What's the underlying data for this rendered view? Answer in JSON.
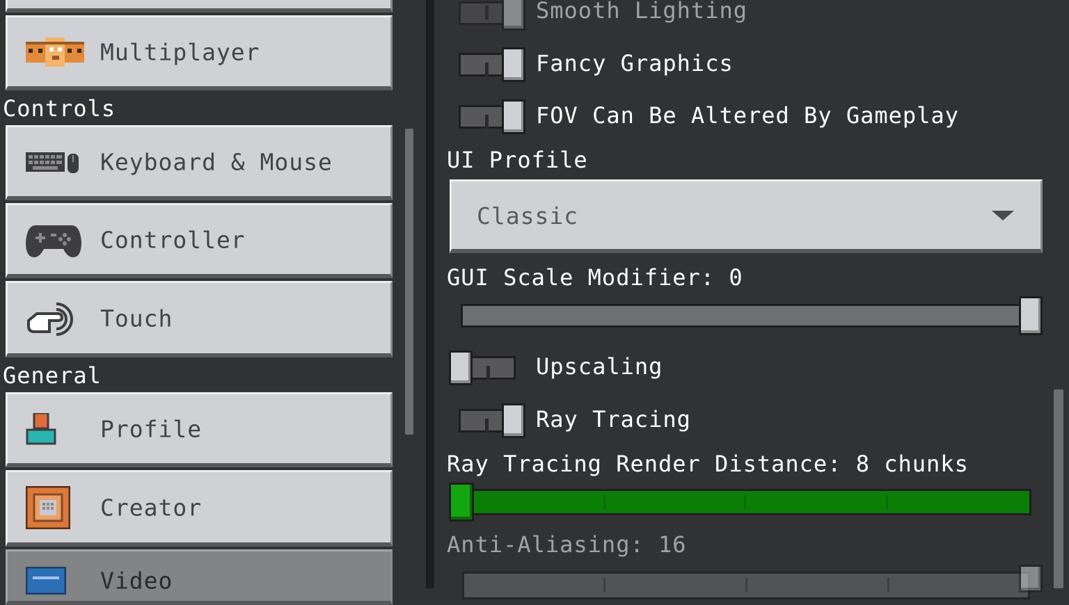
{
  "sidebar": {
    "items": [
      {
        "label": "",
        "icon": "blank"
      },
      {
        "label": "Multiplayer",
        "icon": "multiplayer-faces-icon"
      },
      {
        "label": "Keyboard & Mouse",
        "icon": "keyboard-mouse-icon"
      },
      {
        "label": "Controller",
        "icon": "gamepad-icon"
      },
      {
        "label": "Touch",
        "icon": "touch-hand-icon"
      },
      {
        "label": "Profile",
        "icon": "profile-icon"
      },
      {
        "label": "Creator",
        "icon": "creator-icon"
      },
      {
        "label": "Video",
        "icon": "video-icon"
      }
    ],
    "sections": {
      "controls": "Controls",
      "general": "General"
    }
  },
  "video_settings": {
    "smooth_lighting": {
      "label": "Smooth Lighting",
      "enabled": true
    },
    "fancy_graphics": {
      "label": "Fancy Graphics",
      "enabled": true
    },
    "fov_altered": {
      "label": "FOV Can Be Altered By Gameplay",
      "enabled": true
    },
    "ui_profile": {
      "heading": "UI Profile",
      "value": "Classic"
    },
    "gui_scale": {
      "label": "GUI Scale Modifier: 0",
      "value": 0,
      "fraction": 1.0
    },
    "upscaling": {
      "label": "Upscaling",
      "enabled": false
    },
    "ray_tracing": {
      "label": "Ray Tracing",
      "enabled": true
    },
    "rt_render_distance": {
      "label": "Ray Tracing Render Distance: 8 chunks",
      "value": 8,
      "fraction": 0.0
    },
    "anti_aliasing": {
      "label": "Anti-Aliasing: 16",
      "value": 16
    }
  },
  "colors": {
    "panel": "#313233",
    "button": "#d0d1d4",
    "active_button": "#838486",
    "rt_slider_fill": "#0a7e07"
  }
}
